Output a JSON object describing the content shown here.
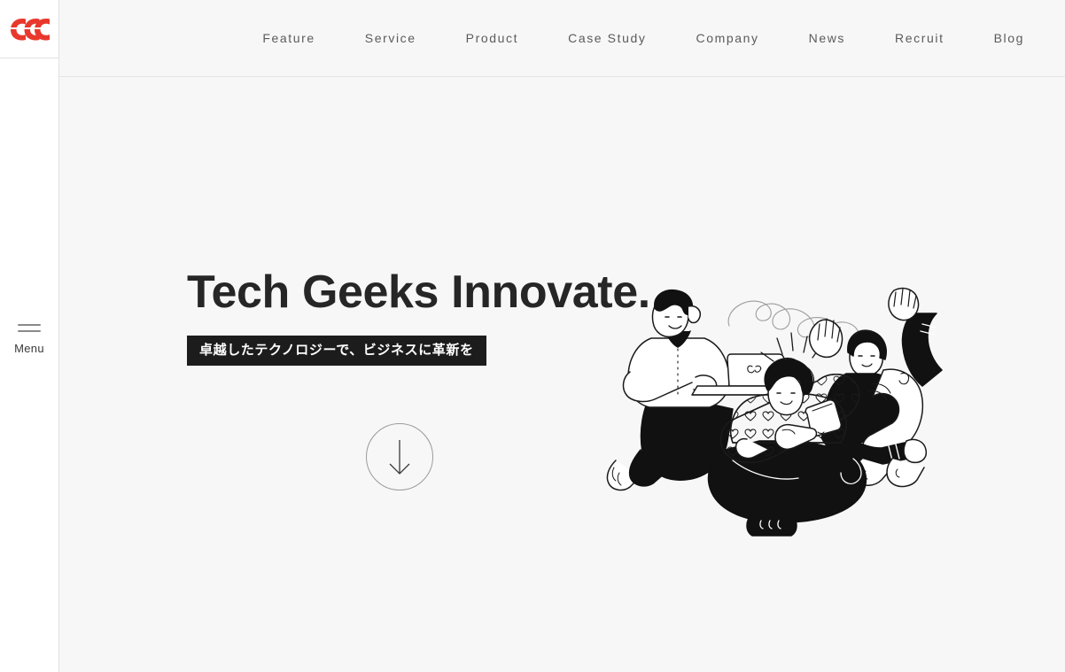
{
  "brand": {
    "logo_icon": "css-logo-mark",
    "logo_color": "#e8382d",
    "logo_alt": "CSS"
  },
  "sidebar": {
    "menu_icon": "hamburger-icon",
    "menu_label": "Menu"
  },
  "header": {
    "background": "#f7f7f7",
    "nav": [
      {
        "label": "Feature"
      },
      {
        "label": "Service"
      },
      {
        "label": "Product"
      },
      {
        "label": "Case Study"
      },
      {
        "label": "Company"
      },
      {
        "label": "News"
      },
      {
        "label": "Recruit"
      },
      {
        "label": "Blog"
      }
    ]
  },
  "hero": {
    "title": "Tech Geeks Innovate.",
    "subtitle": "卓越したテクノロジーで、ビジネスに革新を",
    "subtitle_bg": "#1c1c1c",
    "subtitle_color": "#ffffff",
    "title_color": "#262626",
    "scroll_icon": "arrow-down-icon",
    "illustration_name": "three-people-with-devices-illustration"
  }
}
